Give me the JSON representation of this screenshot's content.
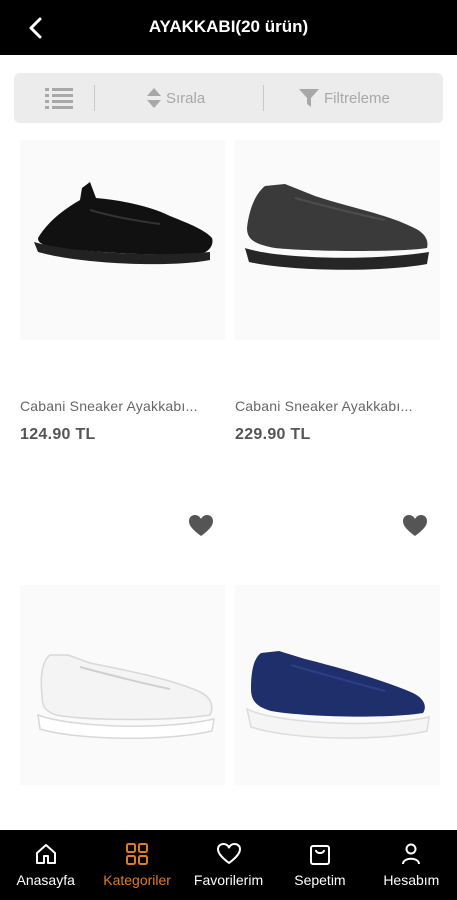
{
  "header": {
    "title": "AYAKKABI(20 ürün)"
  },
  "toolbar": {
    "sort_label": "Sırala",
    "filter_label": "Filtreleme"
  },
  "products": [
    {
      "name": "Cabani Sneaker Ayakkabı...",
      "price": "124.90 TL",
      "color": "black"
    },
    {
      "name": "Cabani Sneaker Ayakkabı...",
      "price": "229.90 TL",
      "color": "dark-grey"
    },
    {
      "name": "",
      "price": "",
      "color": "white"
    },
    {
      "name": "",
      "price": "",
      "color": "navy"
    }
  ],
  "nav": {
    "items": [
      {
        "label": "Anasayfa",
        "icon": "home-icon"
      },
      {
        "label": "Kategoriler",
        "icon": "grid-icon",
        "active": true
      },
      {
        "label": "Favorilerim",
        "icon": "heart-icon"
      },
      {
        "label": "Sepetim",
        "icon": "bag-icon"
      },
      {
        "label": "Hesabım",
        "icon": "user-icon"
      }
    ]
  },
  "colors": {
    "accent": "#e07a22",
    "bar": "#000000"
  }
}
